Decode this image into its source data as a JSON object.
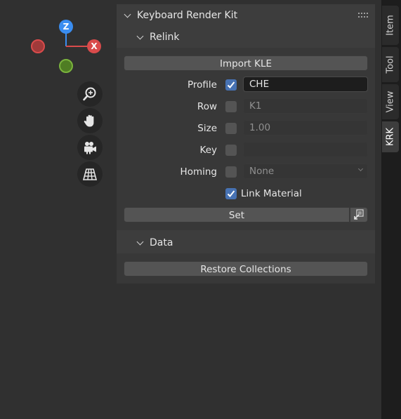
{
  "gizmo": {
    "z_label": "Z",
    "x_label": "X",
    "colors": {
      "x": "#d94b4b",
      "y": "#7ab33d",
      "z": "#3a8df0",
      "neg_x": "#a63a3a"
    }
  },
  "view_tools": [
    "zoom-icon",
    "hand-pan-icon",
    "camera-icon",
    "grid-ortho-icon"
  ],
  "panel": {
    "title": "Keyboard Render Kit",
    "relink": {
      "title": "Relink",
      "import_button": "Import KLE",
      "profile": {
        "label": "Profile",
        "checked": true,
        "value": "CHE"
      },
      "row": {
        "label": "Row",
        "checked": false,
        "value": "K1"
      },
      "size": {
        "label": "Size",
        "checked": false,
        "value": "1.00"
      },
      "key": {
        "label": "Key",
        "checked": false,
        "value": ""
      },
      "homing": {
        "label": "Homing",
        "checked": false,
        "value": "None"
      },
      "link_material": {
        "label": "Link Material",
        "checked": true
      },
      "set_button": "Set"
    },
    "data": {
      "title": "Data",
      "restore_button": "Restore Collections"
    }
  },
  "tabs": [
    {
      "label": "Item",
      "active": false
    },
    {
      "label": "Tool",
      "active": false
    },
    {
      "label": "View",
      "active": false
    },
    {
      "label": "KRK",
      "active": true
    }
  ],
  "colors": {
    "accent": "#4772b3",
    "panel_bg": "#3d3d3d",
    "viewport_bg": "#303030"
  }
}
